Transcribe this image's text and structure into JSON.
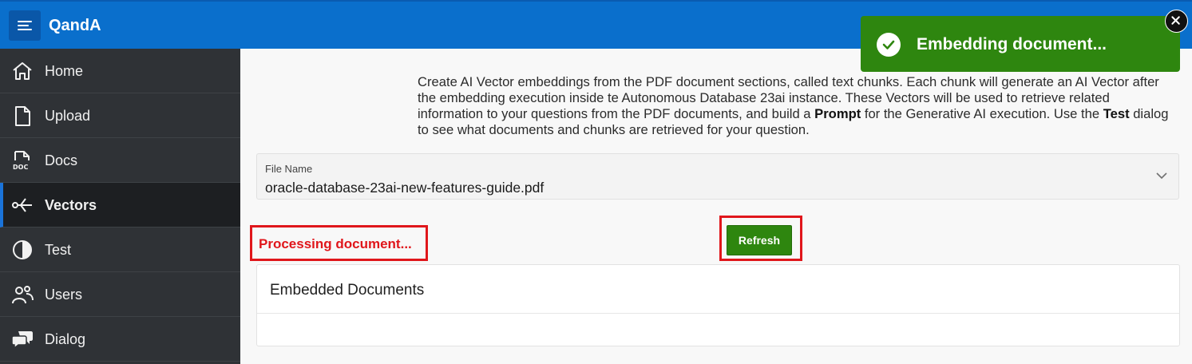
{
  "header": {
    "title": "QandA",
    "menu_icon": "hamburger-icon"
  },
  "sidebar": {
    "items": [
      {
        "label": "Home",
        "icon": "home-icon",
        "active": false
      },
      {
        "label": "Upload",
        "icon": "file-icon",
        "active": false
      },
      {
        "label": "Docs",
        "icon": "doc-file-icon",
        "active": false
      },
      {
        "label": "Vectors",
        "icon": "vector-arrow-icon",
        "active": true
      },
      {
        "label": "Test",
        "icon": "contrast-icon",
        "active": false
      },
      {
        "label": "Users",
        "icon": "users-icon",
        "active": false
      },
      {
        "label": "Dialog",
        "icon": "chat-bubbles-icon",
        "active": false
      }
    ]
  },
  "main": {
    "intro": {
      "part1": "Create AI Vector embeddings from the PDF document sections, called text chunks. Each chunk will generate an AI Vector after the embedding execution inside te Autonomous Database 23ai instance. These Vectors will be used to retrieve related information to your questions from the PDF documents, and build a ",
      "bold1": "Prompt",
      "part2": " for the Generative AI execution. Use the ",
      "bold2": "Test",
      "part3": " dialog to see what documents and chunks are retrieved for your question."
    },
    "file_field": {
      "label": "File Name",
      "value": "oracle-database-23ai-new-features-guide.pdf"
    },
    "processing_text": "Processing document...",
    "refresh_label": "Refresh",
    "region_title": "Embedded Documents"
  },
  "toast": {
    "message": "Embedding document...",
    "icon": "check-circle-icon",
    "close_icon": "close-icon"
  },
  "colors": {
    "header": "#0a6fcc",
    "sidebar": "#2f3236",
    "success": "#2e860f",
    "highlight": "#e0161b"
  }
}
